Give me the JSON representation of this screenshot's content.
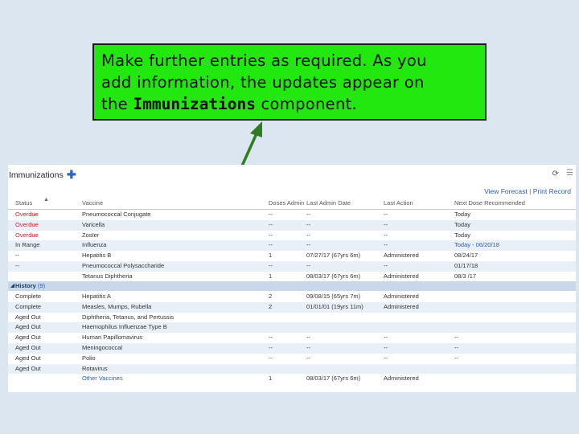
{
  "callout": {
    "line1": "Make further entries as required.  As you",
    "line2": "add information, the updates appear on",
    "line3_prefix": "the ",
    "line3_strong": "Immunizations",
    "line3_suffix": " component."
  },
  "panel": {
    "title": "Immunizations",
    "add_icon": "plus-icon",
    "refresh_icon": "refresh-icon",
    "menu_icon": "menu-icon",
    "links": {
      "view_forecast": "View Forecast",
      "separator": "|",
      "print_record": "Print Record"
    },
    "columns": [
      "Status",
      "Vaccine",
      "Doses Admin",
      "Last Admin Date",
      "Last Action",
      "Next Dose Recommended"
    ],
    "forecast_rows": [
      {
        "status": "Overdue",
        "vaccine": "Pneumococcal Conjugate",
        "doses": "--",
        "last_date": "--",
        "last_action": "--",
        "next": "Today"
      },
      {
        "status": "Overdue",
        "vaccine": "Varicella",
        "doses": "--",
        "last_date": "--",
        "last_action": "--",
        "next": "Today"
      },
      {
        "status": "Overdue",
        "vaccine": "Zoster",
        "doses": "--",
        "last_date": "--",
        "last_action": "--",
        "next": "Today"
      },
      {
        "status": "In Range",
        "vaccine": "Influenza",
        "doses": "--",
        "last_date": "--",
        "last_action": "--",
        "next": "Today - 06/20/18"
      },
      {
        "status": "--",
        "vaccine": "Hepatitis B",
        "doses": "1",
        "last_date": "07/27/17 (67yrs 6m)",
        "last_action": "Administered",
        "next": "08/24/17"
      },
      {
        "status": "--",
        "vaccine": "Pneumococcal Polysaccharide",
        "doses": "--",
        "last_date": "--",
        "last_action": "--",
        "next": "01/17/18"
      },
      {
        "status": "",
        "vaccine": "Tetanus Diphtheria",
        "doses": "1",
        "last_date": "08/03/17 (67yrs 6m)",
        "last_action": "Administered",
        "next": "08/3 /17"
      }
    ],
    "history_label": "History",
    "history_count": "(9)",
    "history_rows": [
      {
        "status": "Complete",
        "vaccine": "Hepatitis A",
        "doses": "2",
        "last_date": "09/08/15 (65yrs 7m)",
        "last_action": "Administered",
        "next": ""
      },
      {
        "status": "Complete",
        "vaccine": "Measles, Mumps, Rubella",
        "doses": "2",
        "last_date": "01/01/01 (19yrs 11m)",
        "last_action": "Administered",
        "next": ""
      },
      {
        "status": "Aged Out",
        "vaccine": "Diphtheria, Tetanus, and Pertussis",
        "doses": "",
        "last_date": "",
        "last_action": "",
        "next": ""
      },
      {
        "status": "Aged Out",
        "vaccine": "Haemophilus Influenzae Type B",
        "doses": "",
        "last_date": "",
        "last_action": "",
        "next": ""
      },
      {
        "status": "Aged Out",
        "vaccine": "Human Papillomavirus",
        "doses": "--",
        "last_date": "--",
        "last_action": "--",
        "next": "--"
      },
      {
        "status": "Aged Out",
        "vaccine": "Meningococcal",
        "doses": "--",
        "last_date": "--",
        "last_action": "--",
        "next": "--"
      },
      {
        "status": "Aged Out",
        "vaccine": "Polio",
        "doses": "--",
        "last_date": "--",
        "last_action": "--",
        "next": "--"
      },
      {
        "status": "Aged Out",
        "vaccine": "Rotavirus",
        "doses": "",
        "last_date": "",
        "last_action": "",
        "next": ""
      },
      {
        "status": "",
        "vaccine": "Other Vaccines",
        "doses": "1",
        "last_date": "08/03/17 (67yrs 6m)",
        "last_action": "Administered",
        "next": ""
      }
    ]
  },
  "colors": {
    "callout_bg": "#22e80f",
    "arrow": "#2f7d1f",
    "overdue": "#c8202a",
    "link": "#2b5ea8",
    "alt_row": "#e9eff7",
    "section_bg": "#c8d8ea"
  }
}
